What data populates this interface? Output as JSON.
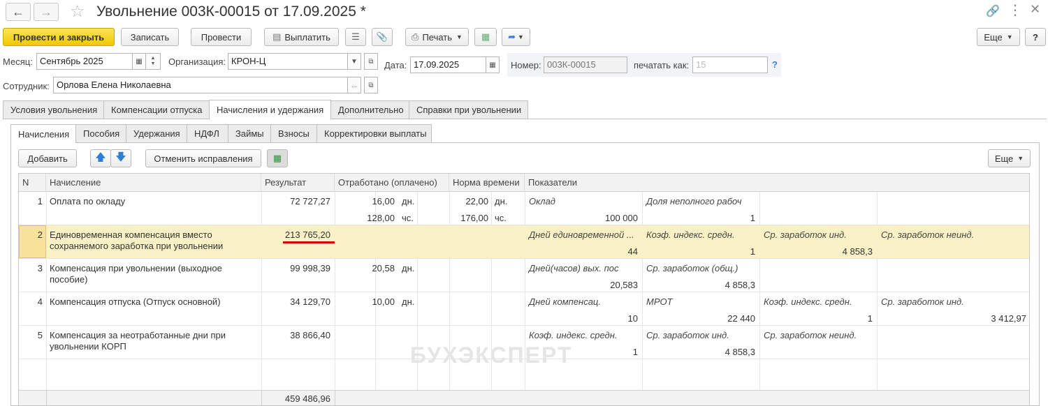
{
  "window": {
    "title": "Увольнение 003К-00015 от 17.09.2025 *"
  },
  "toolbar": {
    "post_close": "Провести и закрыть",
    "save": "Записать",
    "post": "Провести",
    "pay": "Выплатить",
    "print": "Печать",
    "more": "Еще",
    "help": "?"
  },
  "form": {
    "month_label": "Месяц:",
    "month_value": "Сентябрь 2025",
    "org_label": "Организация:",
    "org_value": "КРОН-Ц",
    "date_label": "Дата:",
    "date_value": "17.09.2025",
    "number_label": "Номер:",
    "number_value": "003К-00015",
    "print_as_label": "печатать как:",
    "print_as_placeholder": "15",
    "help_mark": "?",
    "employee_label": "Сотрудник:",
    "employee_value": "Орлова Елена Николаевна"
  },
  "main_tabs": [
    "Условия увольнения",
    "Компенсации отпуска",
    "Начисления и удержания",
    "Дополнительно",
    "Справки при увольнении"
  ],
  "sub_tabs": [
    "Начисления",
    "Пособия",
    "Удержания",
    "НДФЛ",
    "Займы",
    "Взносы",
    "Корректировки выплаты"
  ],
  "grid_toolbar": {
    "add": "Добавить",
    "cancel_fix": "Отменить исправления",
    "more": "Еще"
  },
  "watermark": "БУХЭКСПЕРТ",
  "table": {
    "headers": {
      "n": "N",
      "accrual": "Начисление",
      "result": "Результат",
      "worked": "Отработано (оплачено)",
      "norm": "Норма времени",
      "indicators": "Показатели"
    },
    "rows": [
      {
        "n": "1",
        "name1": "Оплата по окладу",
        "name2": "",
        "result": "72 727,27",
        "worked1": "16,00",
        "worked_unit1": "дн.",
        "worked2": "128,00",
        "worked_unit2": "чс.",
        "norm1": "22,00",
        "norm_unit1": "дн.",
        "norm2": "176,00",
        "norm_unit2": "чс.",
        "ind": [
          {
            "label": "Оклад",
            "value": "100 000"
          },
          {
            "label": "Доля неполного рабоч",
            "value": "1"
          },
          {
            "label": "",
            "value": ""
          },
          {
            "label": "",
            "value": ""
          }
        ]
      },
      {
        "n": "2",
        "name1": "Единовременная компенсация вместо",
        "name2": "сохраняемого заработка при увольнении",
        "result": "213 765,20",
        "worked1": "",
        "worked_unit1": "",
        "worked2": "",
        "worked_unit2": "",
        "norm1": "",
        "norm_unit1": "",
        "norm2": "",
        "norm_unit2": "",
        "ind": [
          {
            "label": "Дней единовременной ...",
            "value": "44"
          },
          {
            "label": "Коэф. индекс. средн.",
            "value": "1"
          },
          {
            "label": "Ср. заработок инд.",
            "value": "4 858,3"
          },
          {
            "label": "Ср. заработок неинд.",
            "value": ""
          }
        ]
      },
      {
        "n": "3",
        "name1": "Компенсация при увольнении (выходное",
        "name2": "пособие)",
        "result": "99 998,39",
        "worked1": "20,58",
        "worked_unit1": "дн.",
        "worked2": "",
        "worked_unit2": "",
        "norm1": "",
        "norm_unit1": "",
        "norm2": "",
        "norm_unit2": "",
        "ind": [
          {
            "label": "Дней(часов) вых. пос",
            "value": "20,583"
          },
          {
            "label": "Ср. заработок (общ.)",
            "value": "4 858,3"
          },
          {
            "label": "",
            "value": ""
          },
          {
            "label": "",
            "value": ""
          }
        ]
      },
      {
        "n": "4",
        "name1": "Компенсация отпуска (Отпуск основной)",
        "name2": "",
        "result": "34 129,70",
        "worked1": "10,00",
        "worked_unit1": "дн.",
        "worked2": "",
        "worked_unit2": "",
        "norm1": "",
        "norm_unit1": "",
        "norm2": "",
        "norm_unit2": "",
        "ind": [
          {
            "label": "Дней компенсац.",
            "value": "10"
          },
          {
            "label": "МРОТ",
            "value": "22 440"
          },
          {
            "label": "Коэф. индекс. средн.",
            "value": "1"
          },
          {
            "label": "Ср. заработок инд.",
            "value": "3 412,97"
          }
        ]
      },
      {
        "n": "5",
        "name1": "Компенсация за неотработанные дни при",
        "name2": "увольнении КОРП",
        "result": "38 866,40",
        "worked1": "",
        "worked_unit1": "",
        "worked2": "",
        "worked_unit2": "",
        "norm1": "",
        "norm_unit1": "",
        "norm2": "",
        "norm_unit2": "",
        "ind": [
          {
            "label": "Коэф. индекс. средн.",
            "value": "1"
          },
          {
            "label": "Ср. заработок инд.",
            "value": "4 858,3"
          },
          {
            "label": "Ср. заработок неинд.",
            "value": ""
          },
          {
            "label": "",
            "value": ""
          }
        ]
      }
    ],
    "total": "459 486,96"
  }
}
